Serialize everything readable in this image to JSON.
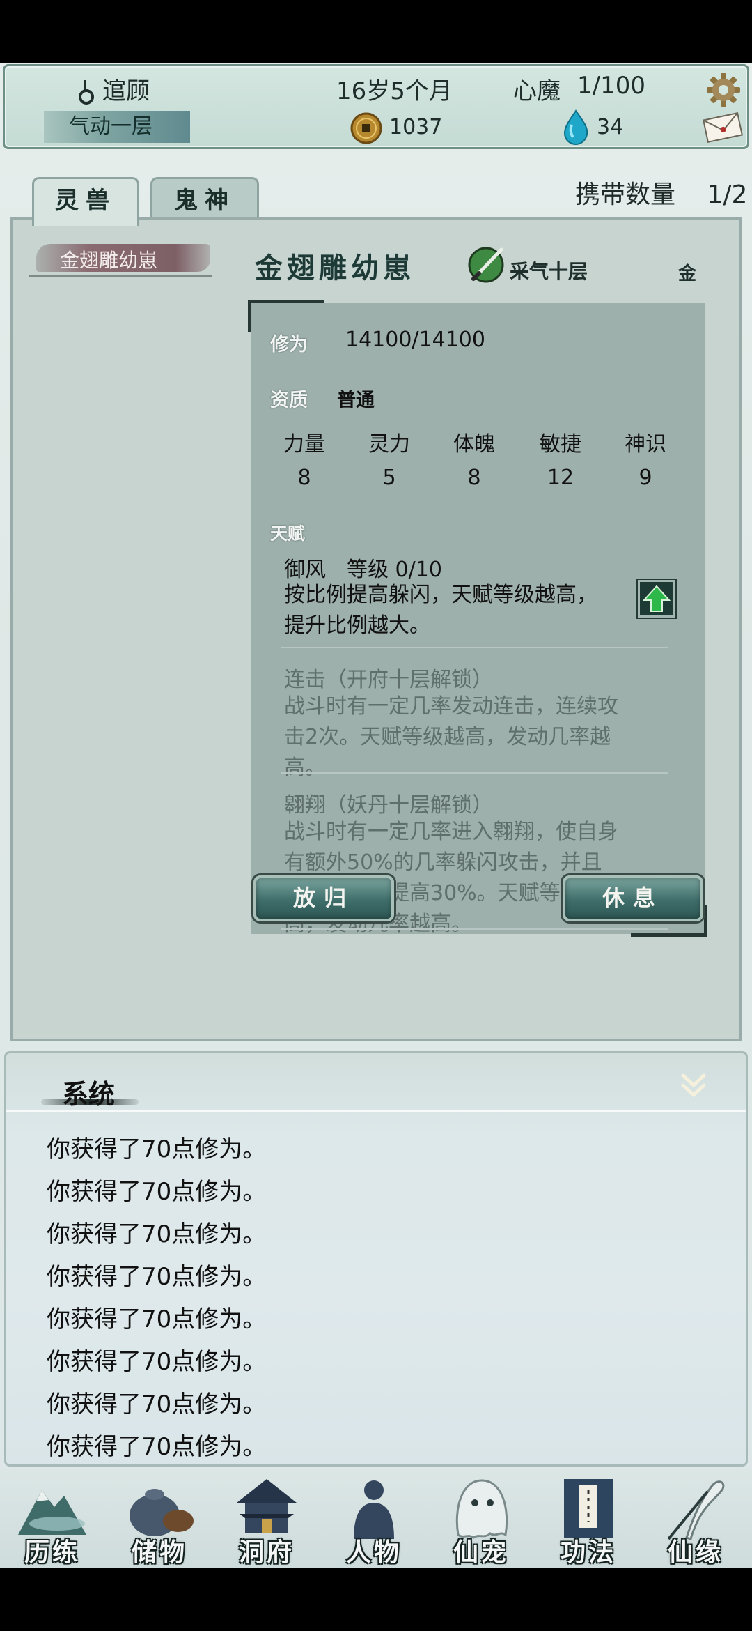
{
  "header": {
    "player_name": "逭顾",
    "realm": "气动一层",
    "age": "16岁5个月",
    "demon_label": "心魔",
    "demon_value": "1/100",
    "coins": "1037",
    "gems": "34"
  },
  "tabs": [
    {
      "label": "灵兽",
      "active": true
    },
    {
      "label": "鬼神",
      "active": false
    }
  ],
  "carry": {
    "label": "携带数量",
    "value": "1/2"
  },
  "pet_list": [
    {
      "name": "金翅雕幼崽",
      "selected": true
    }
  ],
  "pet": {
    "name": "金翅雕幼崽",
    "level": "采气十层",
    "element": "金",
    "cultivation_label": "修为",
    "cultivation_value": "14100/14100",
    "quality_label": "资质",
    "quality_value": "普通",
    "stats": [
      {
        "name": "力量",
        "value": "8"
      },
      {
        "name": "灵力",
        "value": "5"
      },
      {
        "name": "体魄",
        "value": "8"
      },
      {
        "name": "敏捷",
        "value": "12"
      },
      {
        "name": "神识",
        "value": "9"
      }
    ],
    "talent_label": "天赋",
    "talents": [
      {
        "head": "御风　等级  0/10",
        "desc": "按比例提高躲闪，天赋等级越高，提升比例越大。",
        "locked": false
      },
      {
        "head": "连击（开府十层解锁）",
        "desc": "战斗时有一定几率发动连击，连续攻击2次。天赋等级越高，发动几率越高。",
        "locked": true
      },
      {
        "head": "翱翔（妖丹十层解锁）",
        "desc": "战斗时有一定几率进入翱翔，使自身有额外50%的几率躲闪攻击，并且下一次攻击提高30%。天赋等级越高，发动几率越高。",
        "locked": true
      }
    ]
  },
  "actions": {
    "release": "放归",
    "rest": "休息"
  },
  "log": {
    "title": "系统",
    "lines": [
      "你获得了70点修为。",
      "你获得了70点修为。",
      "你获得了70点修为。",
      "你获得了70点修为。",
      "你获得了70点修为。",
      "你获得了70点修为。",
      "你获得了70点修为。",
      "你获得了70点修为。"
    ]
  },
  "nav": [
    {
      "label": "历练",
      "icon": "mountain-icon"
    },
    {
      "label": "储物",
      "icon": "bag-icon"
    },
    {
      "label": "洞府",
      "icon": "pagoda-icon"
    },
    {
      "label": "人物",
      "icon": "person-icon"
    },
    {
      "label": "仙宠",
      "icon": "ghost-pet-icon"
    },
    {
      "label": "功法",
      "icon": "book-icon"
    },
    {
      "label": "仙缘",
      "icon": "crane-icon"
    }
  ],
  "colors": {
    "accent": "#3f6e6a",
    "panel": "#c7d4d0",
    "info_bg": "#9eb0ab"
  }
}
